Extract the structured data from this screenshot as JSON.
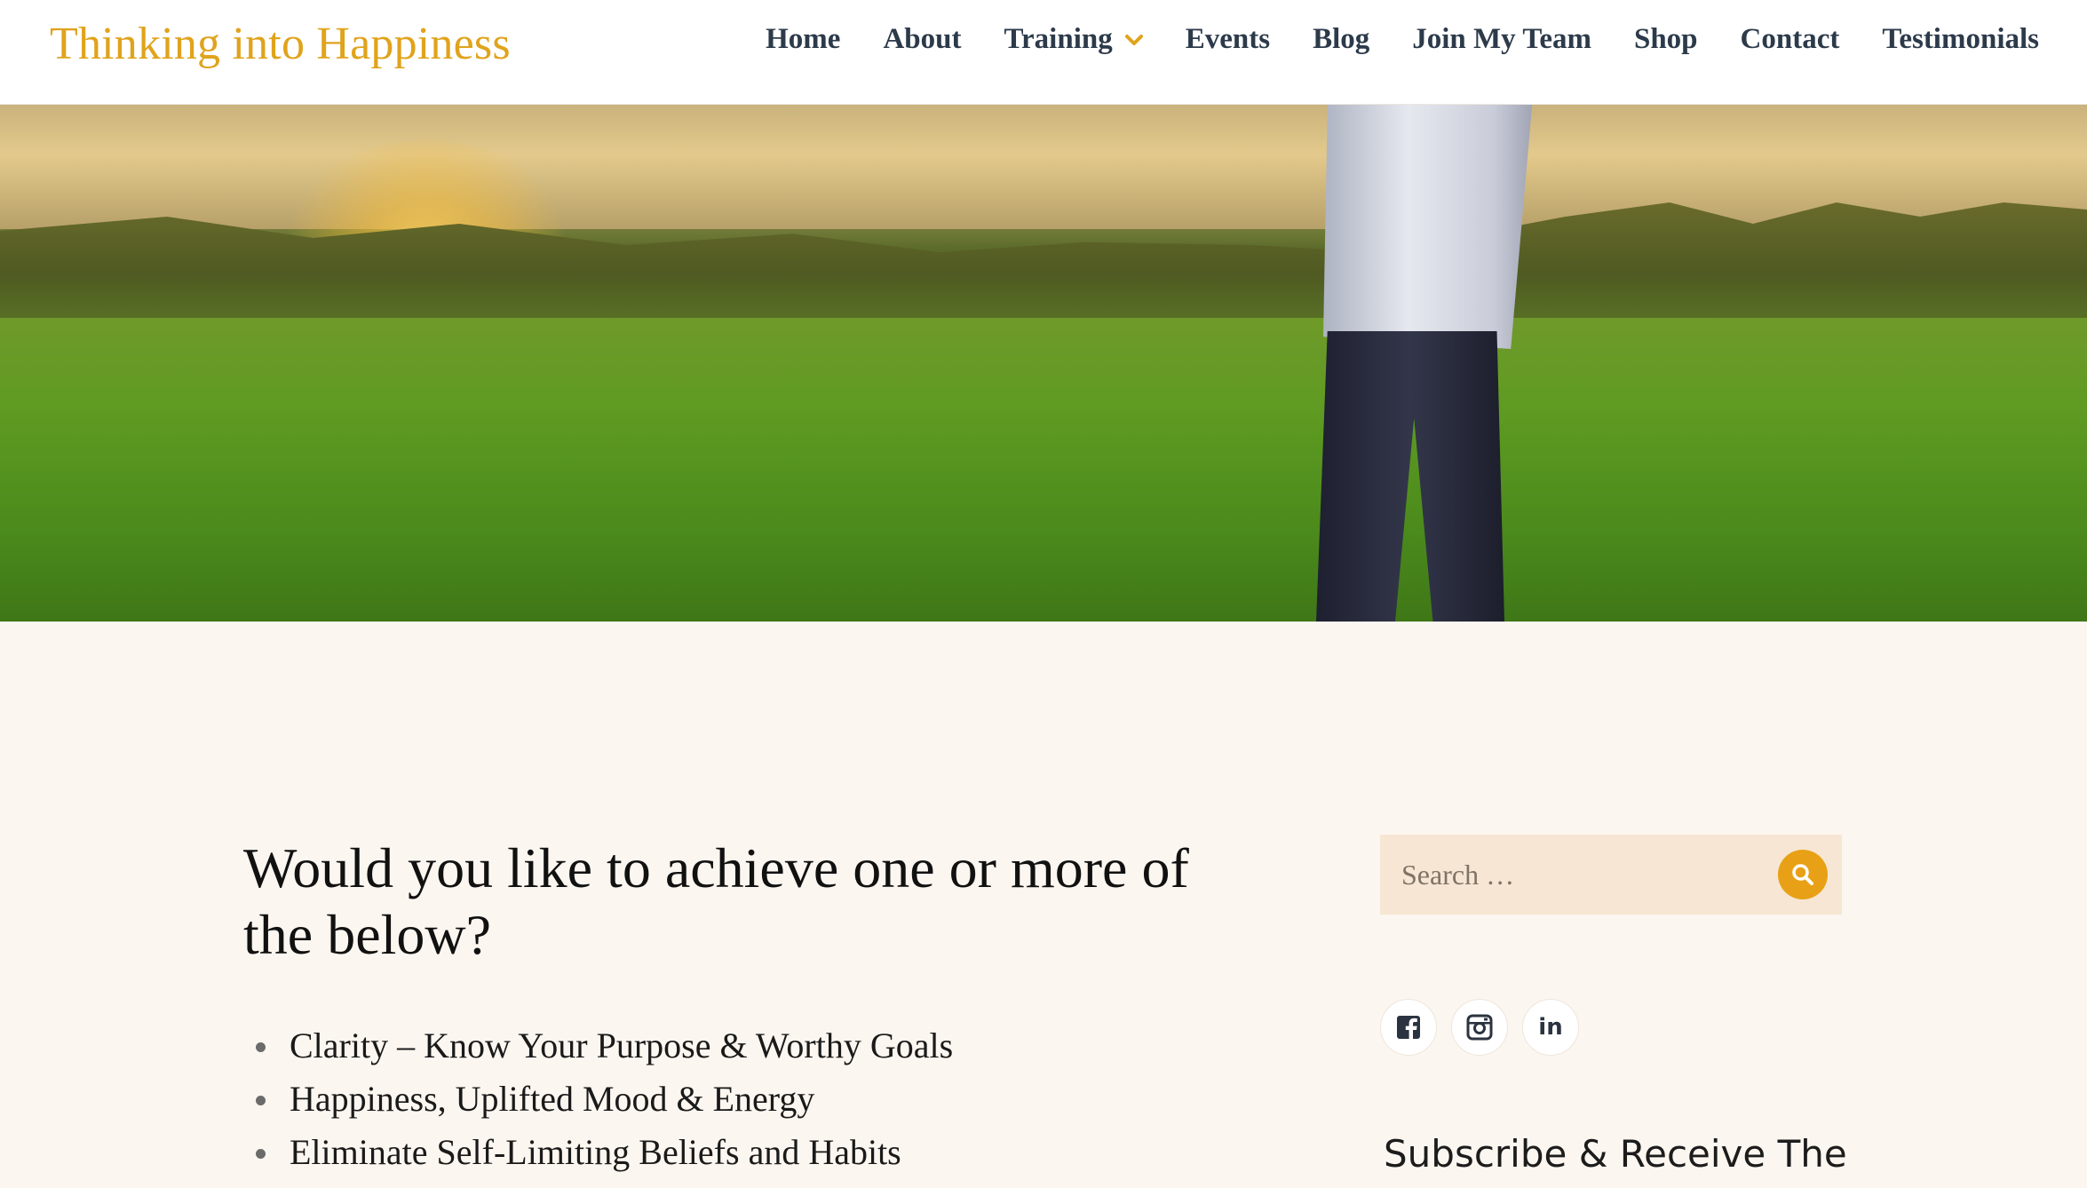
{
  "header": {
    "site_title": "Thinking into Happiness",
    "nav": [
      {
        "label": "Home"
      },
      {
        "label": "About"
      },
      {
        "label": "Training",
        "has_dropdown": true
      },
      {
        "label": "Events"
      },
      {
        "label": "Blog"
      },
      {
        "label": "Join My Team"
      },
      {
        "label": "Shop"
      },
      {
        "label": "Contact"
      },
      {
        "label": "Testimonials"
      }
    ]
  },
  "main": {
    "heading": "Would you like to achieve one or more of the below?",
    "list": [
      "Clarity – Know Your Purpose & Worthy Goals",
      "Happiness, Uplifted Mood & Energy",
      "Eliminate Self-Limiting Beliefs and Habits"
    ]
  },
  "sidebar": {
    "search": {
      "placeholder": "Search …",
      "icon": "search-icon"
    },
    "social": [
      {
        "name": "facebook-icon"
      },
      {
        "name": "instagram-icon"
      },
      {
        "name": "linkedin-icon",
        "glyph": "in"
      }
    ],
    "subscribe_heading": "Subscribe & Receive The"
  },
  "colors": {
    "accent": "#e0a31c",
    "nav_text": "#2c3a4a",
    "page_bg": "#fcf6f0",
    "search_bg": "#f7e6d3"
  }
}
